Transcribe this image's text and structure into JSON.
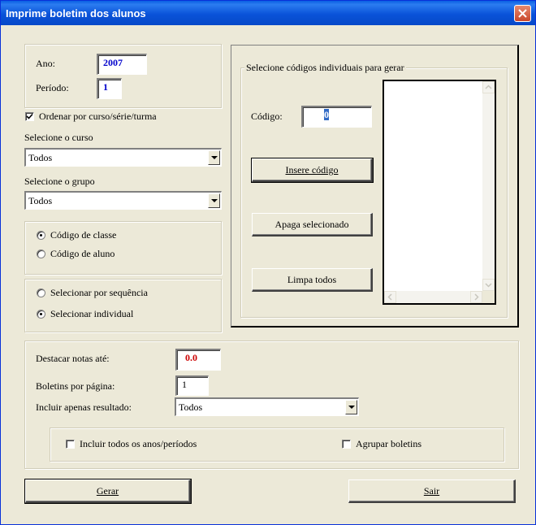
{
  "window": {
    "title": "Imprime boletim dos alunos"
  },
  "ano": {
    "label": "Ano:",
    "value": "2007"
  },
  "periodo": {
    "label": "Período:",
    "value": "1"
  },
  "ordenar": {
    "label": "Ordenar por curso/série/turma",
    "checked": true
  },
  "curso": {
    "label": "Selecione o curso",
    "value": "Todos"
  },
  "grupo": {
    "label": "Selecione o grupo",
    "value": "Todos"
  },
  "codigo_tipo": {
    "classe": "Código de classe",
    "aluno": "Código de aluno",
    "selected": "classe"
  },
  "selecao": {
    "sequencia": "Selecionar por sequência",
    "individual": "Selecionar individual",
    "selected": "individual"
  },
  "individuais": {
    "group_label": "Selecione códigos individuais para gerar",
    "codigo_label": "Código:",
    "codigo_value": "0",
    "insere": "Insere código",
    "apaga": "Apaga selecionado",
    "limpa": "Limpa todos",
    "codes": []
  },
  "opcoes": {
    "destacar_label": "Destacar notas até:",
    "destacar_value": "0.0",
    "destacar_color": "#cc0000",
    "boletins_label": "Boletins por página:",
    "boletins_value": "1",
    "resultado_label": "Incluir apenas resultado:",
    "resultado_value": "Todos",
    "todos_anos": "Incluir todos os anos/períodos",
    "agrupar": "Agrupar boletins"
  },
  "buttons": {
    "gerar": "Gerar",
    "sair": "Sair"
  },
  "colors": {
    "value_blue": "#0000cc"
  }
}
